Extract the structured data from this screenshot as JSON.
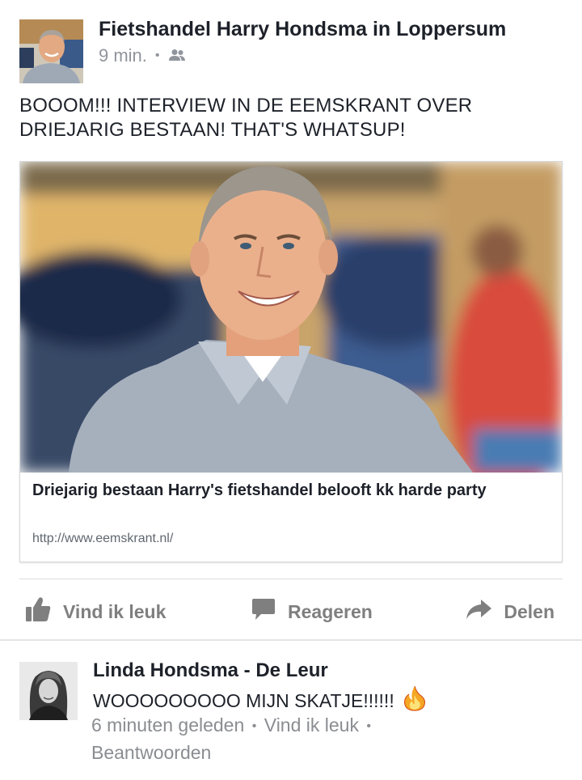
{
  "post": {
    "author": "Fietshandel Harry Hondsma in Loppersum",
    "time": "9 min.",
    "audience_icon": "friends-icon",
    "text": "BOOOM!!! INTERVIEW IN DE EEMSKRANT OVER DRIEJARIG BESTAAN! THAT'S WHATSUP!"
  },
  "link": {
    "title": "Driejarig bestaan Harry's fietshandel belooft kk harde party",
    "url": "http://www.eemskrant.nl/"
  },
  "actions": {
    "like": "Vind ik leuk",
    "comment": "Reageren",
    "share": "Delen"
  },
  "comment": {
    "author": "Linda Hondsma - De Leur",
    "text": "WOOOOOOOOO MIJN SKATJE!!!!!!",
    "emoji": "fire-icon",
    "time": "6 minuten geleden",
    "like": "Vind ik leuk",
    "reply": "Beantwoorden"
  },
  "colors": {
    "action_gray": "#7f7f7f",
    "meta_gray": "#90949c",
    "text": "#1d2129"
  }
}
